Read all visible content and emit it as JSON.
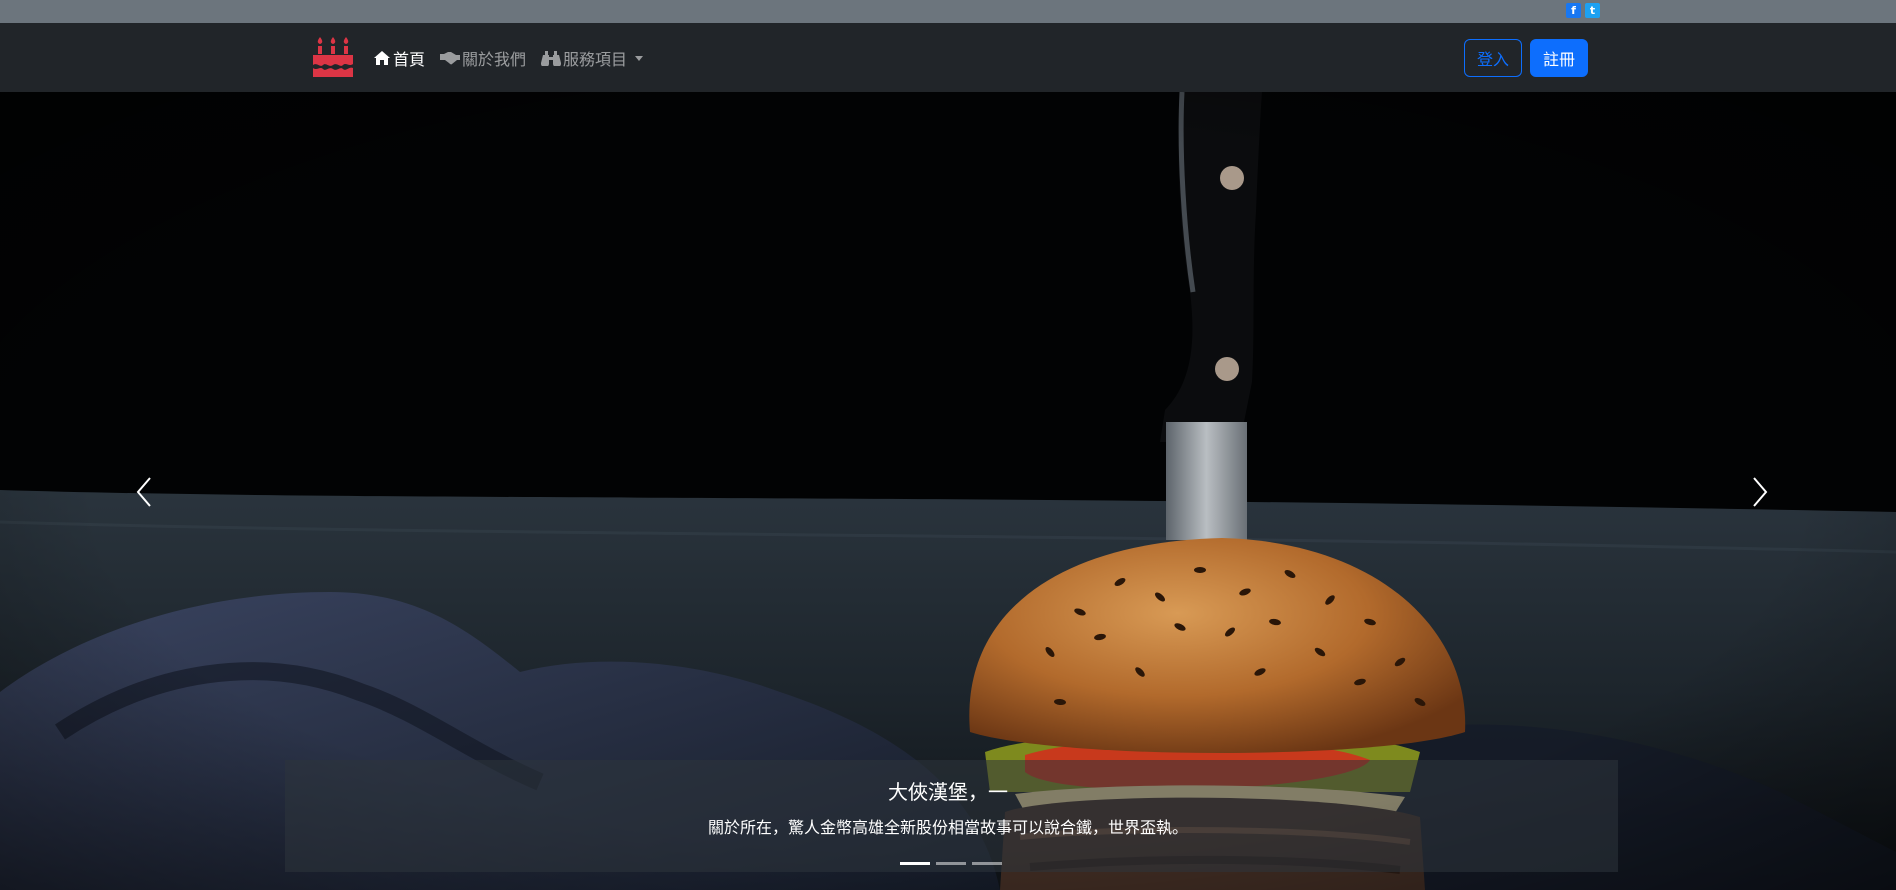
{
  "social": {
    "facebook_icon": "f",
    "twitter_icon": "t"
  },
  "brand": {
    "icon": "birthday-cake-icon",
    "color": "#dc3545"
  },
  "nav": {
    "home_label": "首頁",
    "about_label": "關於我們",
    "services_label": "服務項目"
  },
  "buttons": {
    "login_label": "登入",
    "signup_label": "註冊"
  },
  "carousel": {
    "caption_title": "大俠漢堡，一",
    "caption_text": "關於所在，驚人金幣高雄全新股份相當故事可以說合鐵，世界盃執。",
    "slide_count": 3,
    "active_slide": 1
  },
  "colors": {
    "primary": "#0d6efd",
    "navbar": "#212529",
    "topbar": "#6c757d"
  }
}
